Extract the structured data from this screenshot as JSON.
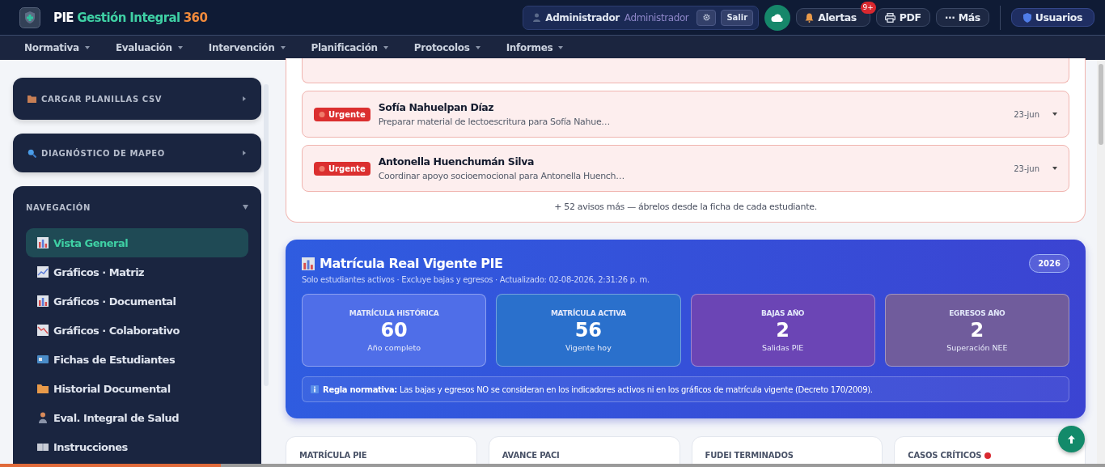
{
  "brand": {
    "prefix": "PIE",
    "name": "Gestión Integral",
    "suffix": "360"
  },
  "user": {
    "name": "Administrador",
    "role": "Administrador",
    "logout": "Salir"
  },
  "alerts": {
    "label": "Alertas",
    "badge": "9+"
  },
  "actions": [
    {
      "kind": "pdf",
      "label": "PDF"
    },
    {
      "kind": "more",
      "label": "··· Más"
    }
  ],
  "users_button": "Usuarios",
  "menu": [
    "Normativa",
    "Evaluación",
    "Intervención",
    "Planificación",
    "Protocolos",
    "Informes"
  ],
  "sidebar": {
    "panels": [
      {
        "kind": "csv",
        "title": "CARGAR PLANILLAS CSV",
        "expanded": false
      },
      {
        "kind": "search",
        "title": "DIAGNÓSTICO DE MAPEO",
        "expanded": false
      }
    ],
    "navigation": {
      "title": "NAVEGACIÓN",
      "expanded": true,
      "items": [
        {
          "kind": "bars",
          "label": "Vista General",
          "selected": true
        },
        {
          "kind": "trend",
          "label": "Gráficos · Matriz",
          "selected": false
        },
        {
          "kind": "bars",
          "label": "Gráficos · Documental",
          "selected": false
        },
        {
          "kind": "down",
          "label": "Gráficos · Colaborativo",
          "selected": false
        },
        {
          "kind": "card",
          "label": "Fichas de Estudiantes",
          "selected": false
        },
        {
          "kind": "folder",
          "label": "Historial Documental",
          "selected": false
        },
        {
          "kind": "person",
          "label": "Eval. Integral de Salud",
          "selected": false
        },
        {
          "kind": "book",
          "label": "Instrucciones",
          "selected": false
        }
      ]
    }
  },
  "loading": {
    "level": 0.2
  },
  "notices": {
    "items": [
      {
        "tag": "Urgente",
        "name": "Sofía Nahuelpan Díaz",
        "text": "Preparar material de lectoescritura para Sofía Nahue…",
        "date": "23-jun"
      },
      {
        "tag": "Urgente",
        "name": "Antonella Huenchumán Silva",
        "text": "Coordinar apoyo socioemocional para Antonella Huench…",
        "date": "23-jun"
      }
    ],
    "more": "+ 52 avisos más — ábrelos desde la ficha de cada estudiante."
  },
  "enrollment": {
    "title": "Matrícula Real Vigente PIE",
    "year": "2026",
    "subtitle": "Solo estudiantes activos · Excluye bajas y egresos · Actualizado: 02-08-2026, 2:31:26 p. m.",
    "stats": [
      {
        "label": "MATRÍCULA HISTÓRICA",
        "value": "60",
        "note": "Año completo",
        "color": "#4f6ee8"
      },
      {
        "label": "MATRÍCULA ACTIVA",
        "value": "56",
        "note": "Vigente hoy",
        "color": "#2a70cc"
      },
      {
        "label": "BAJAS AÑO",
        "value": "2",
        "note": "Salidas PIE",
        "color": "#6b45b5"
      },
      {
        "label": "EGRESOS AÑO",
        "value": "2",
        "note": "Superación NEE",
        "color": "#705c9c"
      }
    ],
    "rule": "**Regla normativa:** Las bajas y egresos NO se consideran en los indicadores activos ni en los gráficos de matrícula vigente (Decreto 170/2009)."
  },
  "kpis": [
    {
      "label": "MATRÍCULA PIE",
      "alert": false
    },
    {
      "label": "AVANCE PACI",
      "alert": false
    },
    {
      "label": "FUDEI TERMINADOS",
      "alert": false
    },
    {
      "label": "CASOS CRÍTICOS",
      "alert": true
    }
  ]
}
